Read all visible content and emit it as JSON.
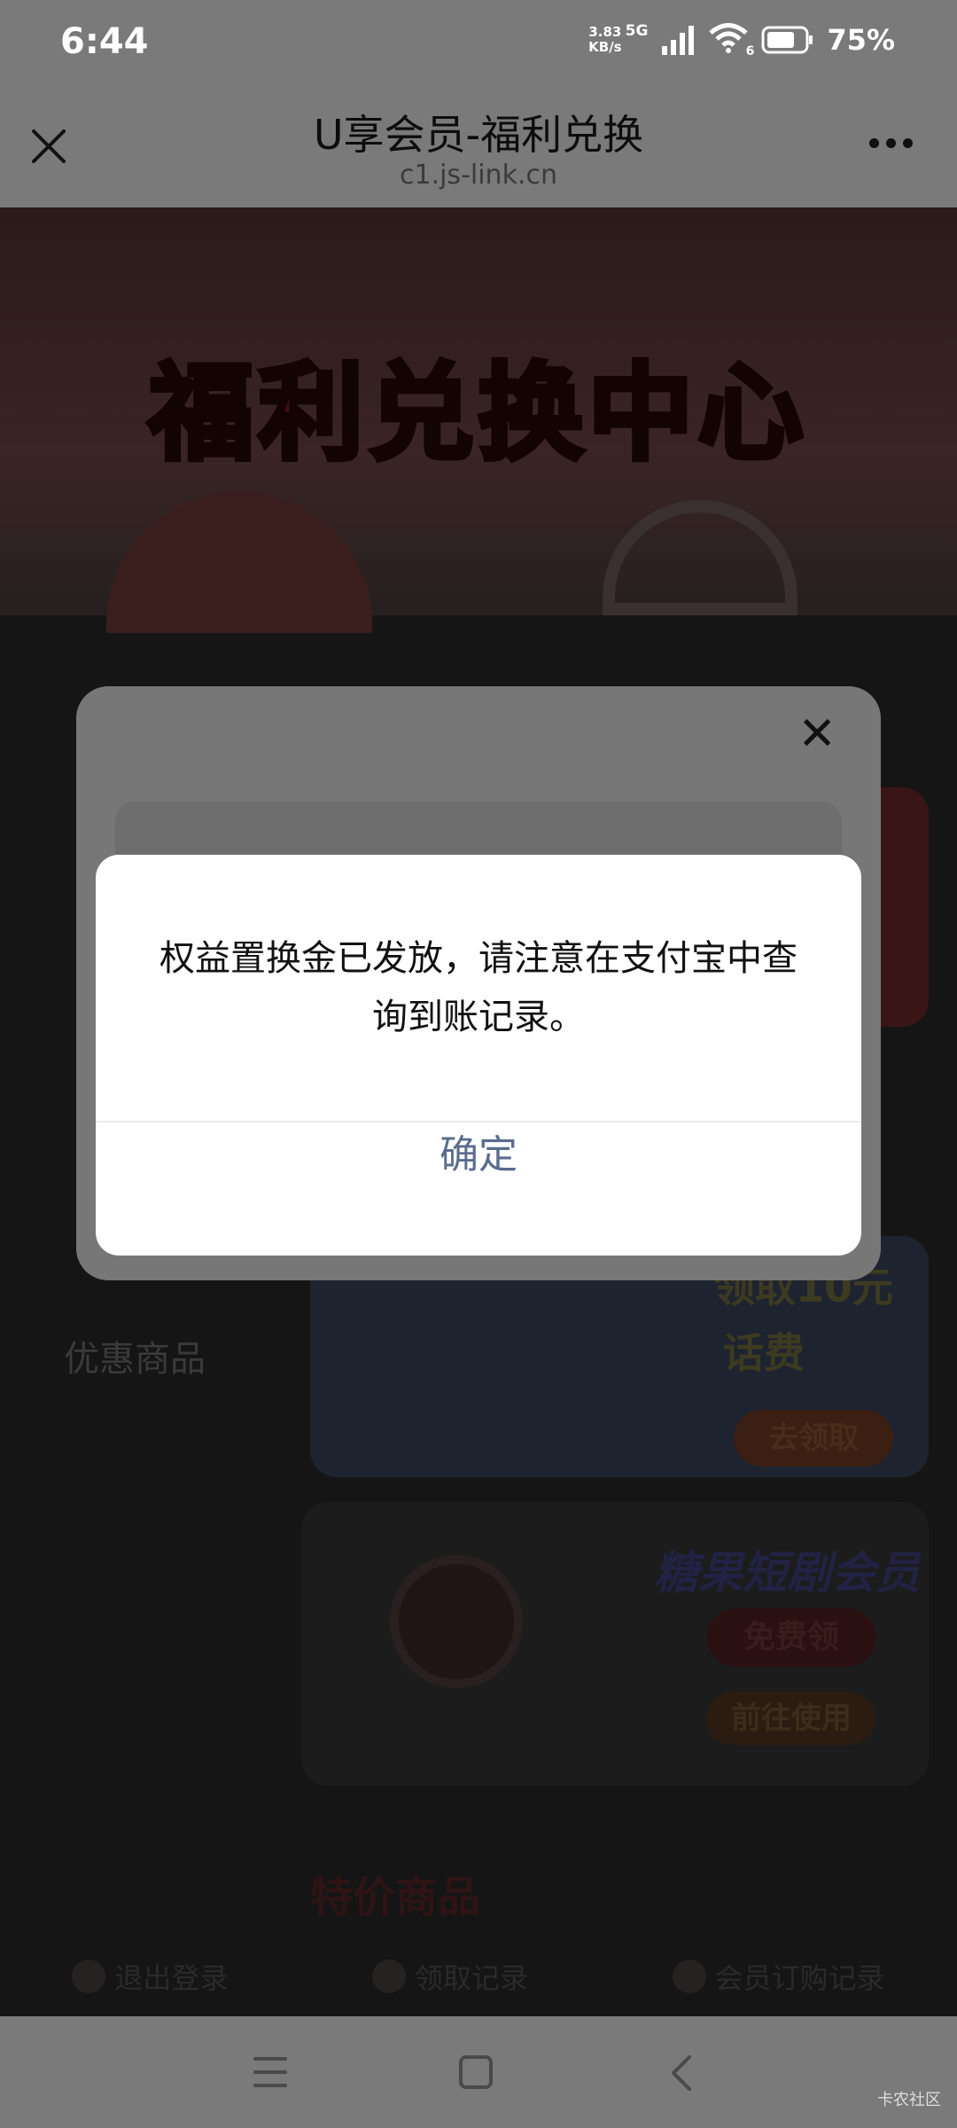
{
  "status_bar": {
    "time": "6:44",
    "net_speed_value": "3.83",
    "net_speed_unit": "KB/s",
    "network_type": "5G",
    "wifi_badge": "6",
    "battery_percent": "75%"
  },
  "title_bar": {
    "title": "U享会员-福利兑换",
    "url": "c1.js-link.cn"
  },
  "background_page": {
    "banner_title": "福利兑换中心",
    "menu_discount": "优惠商品",
    "card1_line1": "领取10元",
    "card1_line2": "话费",
    "card1_button": "去领取",
    "card2_title": "糖果短剧会员",
    "card2_button1": "免费领",
    "card2_button2": "前往使用",
    "special_heading": "特价商品",
    "bottom_links": [
      "退出登录",
      "领取记录",
      "会员订购记录"
    ]
  },
  "outer_dialog": {
    "close_glyph": "✕"
  },
  "alert": {
    "message": "权益置换金已发放，请注意在支付宝中查询到账记录。",
    "confirm_label": "确定"
  },
  "watermark": "卡农社区",
  "colors": {
    "overlay_bg": "#151515",
    "alert_button_text": "#5a6c8e"
  }
}
